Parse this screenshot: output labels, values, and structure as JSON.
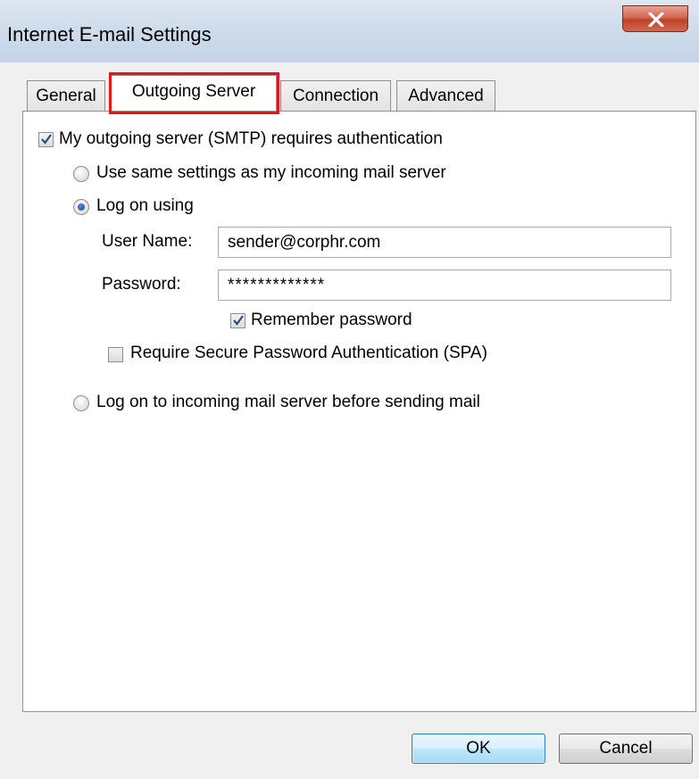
{
  "window": {
    "title": "Internet E-mail Settings"
  },
  "tabs": [
    {
      "label": "General",
      "active": false
    },
    {
      "label": "Outgoing Server",
      "active": true
    },
    {
      "label": "Connection",
      "active": false
    },
    {
      "label": "Advanced",
      "active": false
    }
  ],
  "auth": {
    "requires_auth_label": "My outgoing server (SMTP) requires authentication",
    "requires_auth_checked": true,
    "same_settings_label": "Use same settings as my incoming mail server",
    "log_on_using_label": "Log on using",
    "log_on_incoming_label": "Log on to incoming mail server before sending mail",
    "selected_option": "log_on_using"
  },
  "credentials": {
    "username_label": "User Name:",
    "username_value": "sender@corphr.com",
    "password_label": "Password:",
    "password_value": "*************",
    "remember_label": "Remember password",
    "remember_checked": true,
    "spa_label": "Require Secure Password Authentication (SPA)",
    "spa_checked": false
  },
  "buttons": {
    "ok": "OK",
    "cancel": "Cancel"
  },
  "colors": {
    "highlight": "#e8141b",
    "close_button": "#c0412a",
    "titlebar": "#cfdceb"
  }
}
